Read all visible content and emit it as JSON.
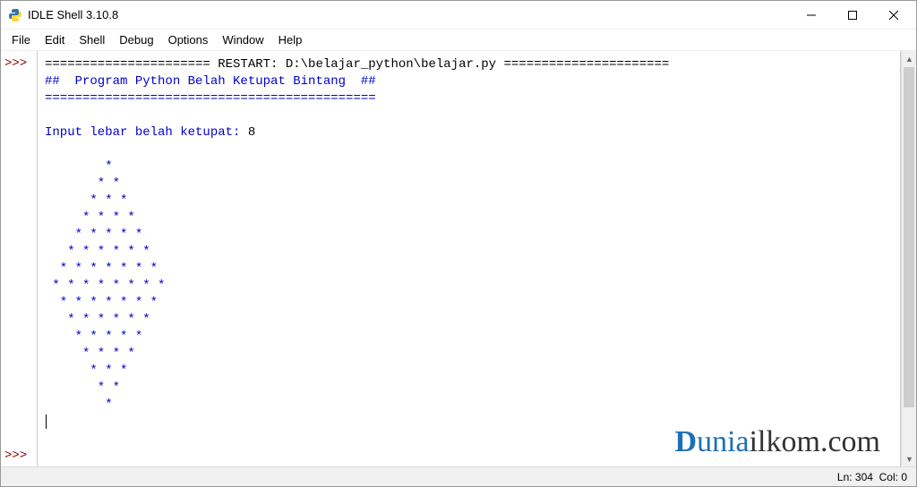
{
  "window": {
    "title": "IDLE Shell 3.10.8"
  },
  "menu": {
    "file": "File",
    "edit": "Edit",
    "shell": "Shell",
    "debug": "Debug",
    "options": "Options",
    "window": "Window",
    "help": "Help"
  },
  "prompt": {
    "top": ">>>",
    "bottom": ">>>"
  },
  "shell": {
    "restart_line": "====================== RESTART: D:\\belajar_python\\belajar.py ======================",
    "header_title": "##  Program Python Belah Ketupat Bintang  ##",
    "header_divider": "============================================",
    "blank1": "",
    "input_prompt": "Input lebar belah ketupat: ",
    "input_value": "8",
    "blank2": "",
    "pattern": [
      "        * ",
      "       * * ",
      "      * * * ",
      "     * * * * ",
      "    * * * * * ",
      "   * * * * * * ",
      "  * * * * * * * ",
      " * * * * * * * * ",
      "  * * * * * * * ",
      "   * * * * * * ",
      "    * * * * * ",
      "     * * * * ",
      "      * * * ",
      "       * * ",
      "        * "
    ]
  },
  "status": {
    "ln_label": "Ln:",
    "ln": "304",
    "col_label": "Col:",
    "col": "0"
  },
  "watermark": {
    "part1": "D",
    "part2": "unia",
    "part3": "ilkom.com"
  }
}
